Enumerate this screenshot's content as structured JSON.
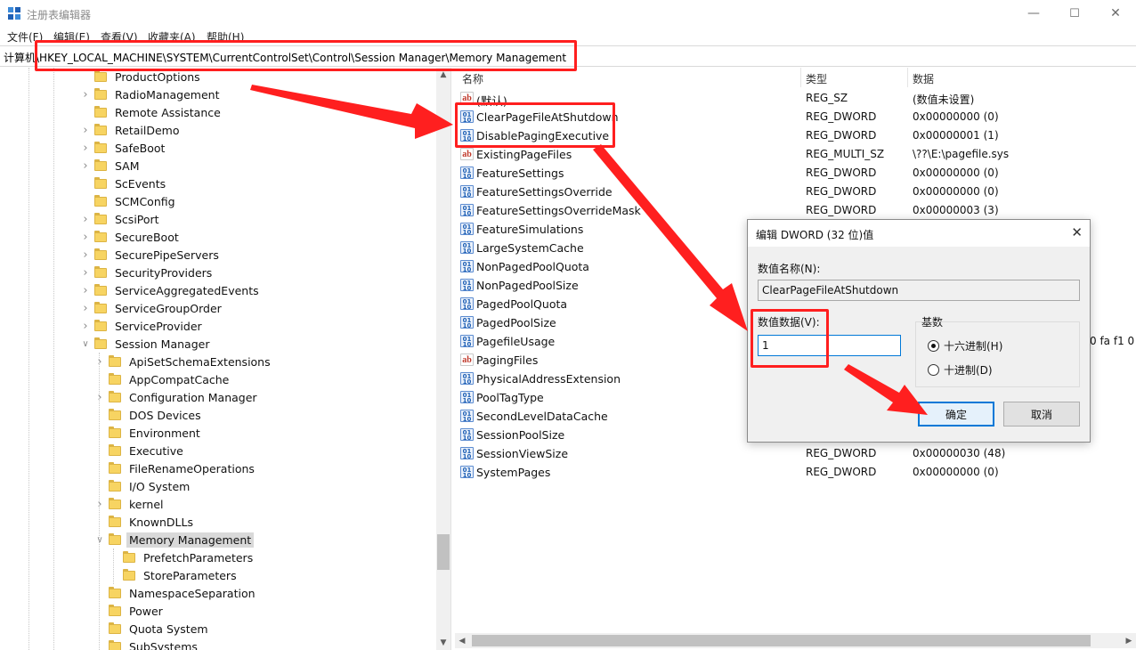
{
  "window": {
    "title": "注册表编辑器",
    "minimize_glyph": "—",
    "maximize_glyph": "☐",
    "close_glyph": "✕"
  },
  "menu": [
    "文件(F)",
    "编辑(E)",
    "查看(V)",
    "收藏夹(A)",
    "帮助(H)"
  ],
  "address": {
    "path": "计算机\\HKEY_LOCAL_MACHINE\\SYSTEM\\CurrentControlSet\\Control\\Session Manager\\Memory Management"
  },
  "tree": {
    "items": [
      {
        "label": "ProductOptions",
        "expandable": false
      },
      {
        "label": "RadioManagement",
        "expandable": true
      },
      {
        "label": "Remote Assistance",
        "expandable": false
      },
      {
        "label": "RetailDemo",
        "expandable": true
      },
      {
        "label": "SafeBoot",
        "expandable": true
      },
      {
        "label": "SAM",
        "expandable": true
      },
      {
        "label": "ScEvents",
        "expandable": false
      },
      {
        "label": "SCMConfig",
        "expandable": false
      },
      {
        "label": "ScsiPort",
        "expandable": true
      },
      {
        "label": "SecureBoot",
        "expandable": true
      },
      {
        "label": "SecurePipeServers",
        "expandable": true
      },
      {
        "label": "SecurityProviders",
        "expandable": true
      },
      {
        "label": "ServiceAggregatedEvents",
        "expandable": true
      },
      {
        "label": "ServiceGroupOrder",
        "expandable": true
      },
      {
        "label": "ServiceProvider",
        "expandable": true
      },
      {
        "label": "Session Manager",
        "expandable": true,
        "expanded": true
      },
      {
        "label": "ApiSetSchemaExtensions",
        "expandable": true,
        "level": 1
      },
      {
        "label": "AppCompatCache",
        "expandable": false,
        "level": 1
      },
      {
        "label": "Configuration Manager",
        "expandable": true,
        "level": 1
      },
      {
        "label": "DOS Devices",
        "expandable": false,
        "level": 1
      },
      {
        "label": "Environment",
        "expandable": false,
        "level": 1
      },
      {
        "label": "Executive",
        "expandable": false,
        "level": 1
      },
      {
        "label": "FileRenameOperations",
        "expandable": false,
        "level": 1
      },
      {
        "label": "I/O System",
        "expandable": false,
        "level": 1
      },
      {
        "label": "kernel",
        "expandable": true,
        "level": 1
      },
      {
        "label": "KnownDLLs",
        "expandable": false,
        "level": 1
      },
      {
        "label": "Memory Management",
        "expandable": true,
        "expanded": true,
        "selected": true,
        "level": 1
      },
      {
        "label": "PrefetchParameters",
        "expandable": false,
        "level": 2
      },
      {
        "label": "StoreParameters",
        "expandable": false,
        "level": 2
      },
      {
        "label": "NamespaceSeparation",
        "expandable": false,
        "level": 1
      },
      {
        "label": "Power",
        "expandable": false,
        "level": 1
      },
      {
        "label": "Quota System",
        "expandable": false,
        "level": 1
      },
      {
        "label": "SubSystems",
        "expandable": false,
        "level": 1
      }
    ]
  },
  "values": {
    "headers": {
      "name": "名称",
      "type": "类型",
      "data": "数据"
    },
    "rows": [
      {
        "icon": "ab",
        "name": "(默认)",
        "type": "REG_SZ",
        "data": "(数值未设置)"
      },
      {
        "icon": "bin",
        "name": "ClearPageFileAtShutdown",
        "type": "REG_DWORD",
        "data": "0x00000000 (0)"
      },
      {
        "icon": "bin",
        "name": "DisablePagingExecutive",
        "type": "REG_DWORD",
        "data": "0x00000001 (1)"
      },
      {
        "icon": "ab",
        "name": "ExistingPageFiles",
        "type": "REG_MULTI_SZ",
        "data": "\\??\\E:\\pagefile.sys"
      },
      {
        "icon": "bin",
        "name": "FeatureSettings",
        "type": "REG_DWORD",
        "data": "0x00000000 (0)"
      },
      {
        "icon": "bin",
        "name": "FeatureSettingsOverride",
        "type": "REG_DWORD",
        "data": "0x00000000 (0)"
      },
      {
        "icon": "bin",
        "name": "FeatureSettingsOverrideMask",
        "type": "REG_DWORD",
        "data": "0x00000003 (3)"
      },
      {
        "icon": "bin",
        "name": "FeatureSimulations",
        "type": "",
        "data": ""
      },
      {
        "icon": "bin",
        "name": "LargeSystemCache",
        "type": "",
        "data": ""
      },
      {
        "icon": "bin",
        "name": "NonPagedPoolQuota",
        "type": "",
        "data": ""
      },
      {
        "icon": "bin",
        "name": "NonPagedPoolSize",
        "type": "",
        "data": ""
      },
      {
        "icon": "bin",
        "name": "PagedPoolQuota",
        "type": "",
        "data": ""
      },
      {
        "icon": "bin",
        "name": "PagedPoolSize",
        "type": "",
        "data": ""
      },
      {
        "icon": "bin",
        "name": "PagefileUsage",
        "type": "",
        "data": "0 fa f1 0"
      },
      {
        "icon": "ab",
        "name": "PagingFiles",
        "type": "",
        "data": ""
      },
      {
        "icon": "bin",
        "name": "PhysicalAddressExtension",
        "type": "",
        "data": ""
      },
      {
        "icon": "bin",
        "name": "PoolTagType",
        "type": "",
        "data": ""
      },
      {
        "icon": "bin",
        "name": "SecondLevelDataCache",
        "type": "",
        "data": ""
      },
      {
        "icon": "bin",
        "name": "SessionPoolSize",
        "type": "",
        "data": ""
      },
      {
        "icon": "bin",
        "name": "SessionViewSize",
        "type": "REG_DWORD",
        "data": "0x00000030 (48)"
      },
      {
        "icon": "bin",
        "name": "SystemPages",
        "type": "REG_DWORD",
        "data": "0x00000000 (0)"
      }
    ]
  },
  "dialog": {
    "title": "编辑 DWORD (32 位)值",
    "close_glyph": "✕",
    "name_label": "数值名称(N):",
    "name_value": "ClearPageFileAtShutdown",
    "data_label": "数值数据(V):",
    "data_value": "1",
    "base_label": "基数",
    "radio_hex": "十六进制(H)",
    "radio_dec": "十进制(D)",
    "selected_base": "hex",
    "ok_label": "确定",
    "cancel_label": "取消"
  },
  "colors": {
    "annotation_red": "#ff1f1f",
    "accent_blue": "#0078d7",
    "folder_yellow": "#f7d462"
  }
}
